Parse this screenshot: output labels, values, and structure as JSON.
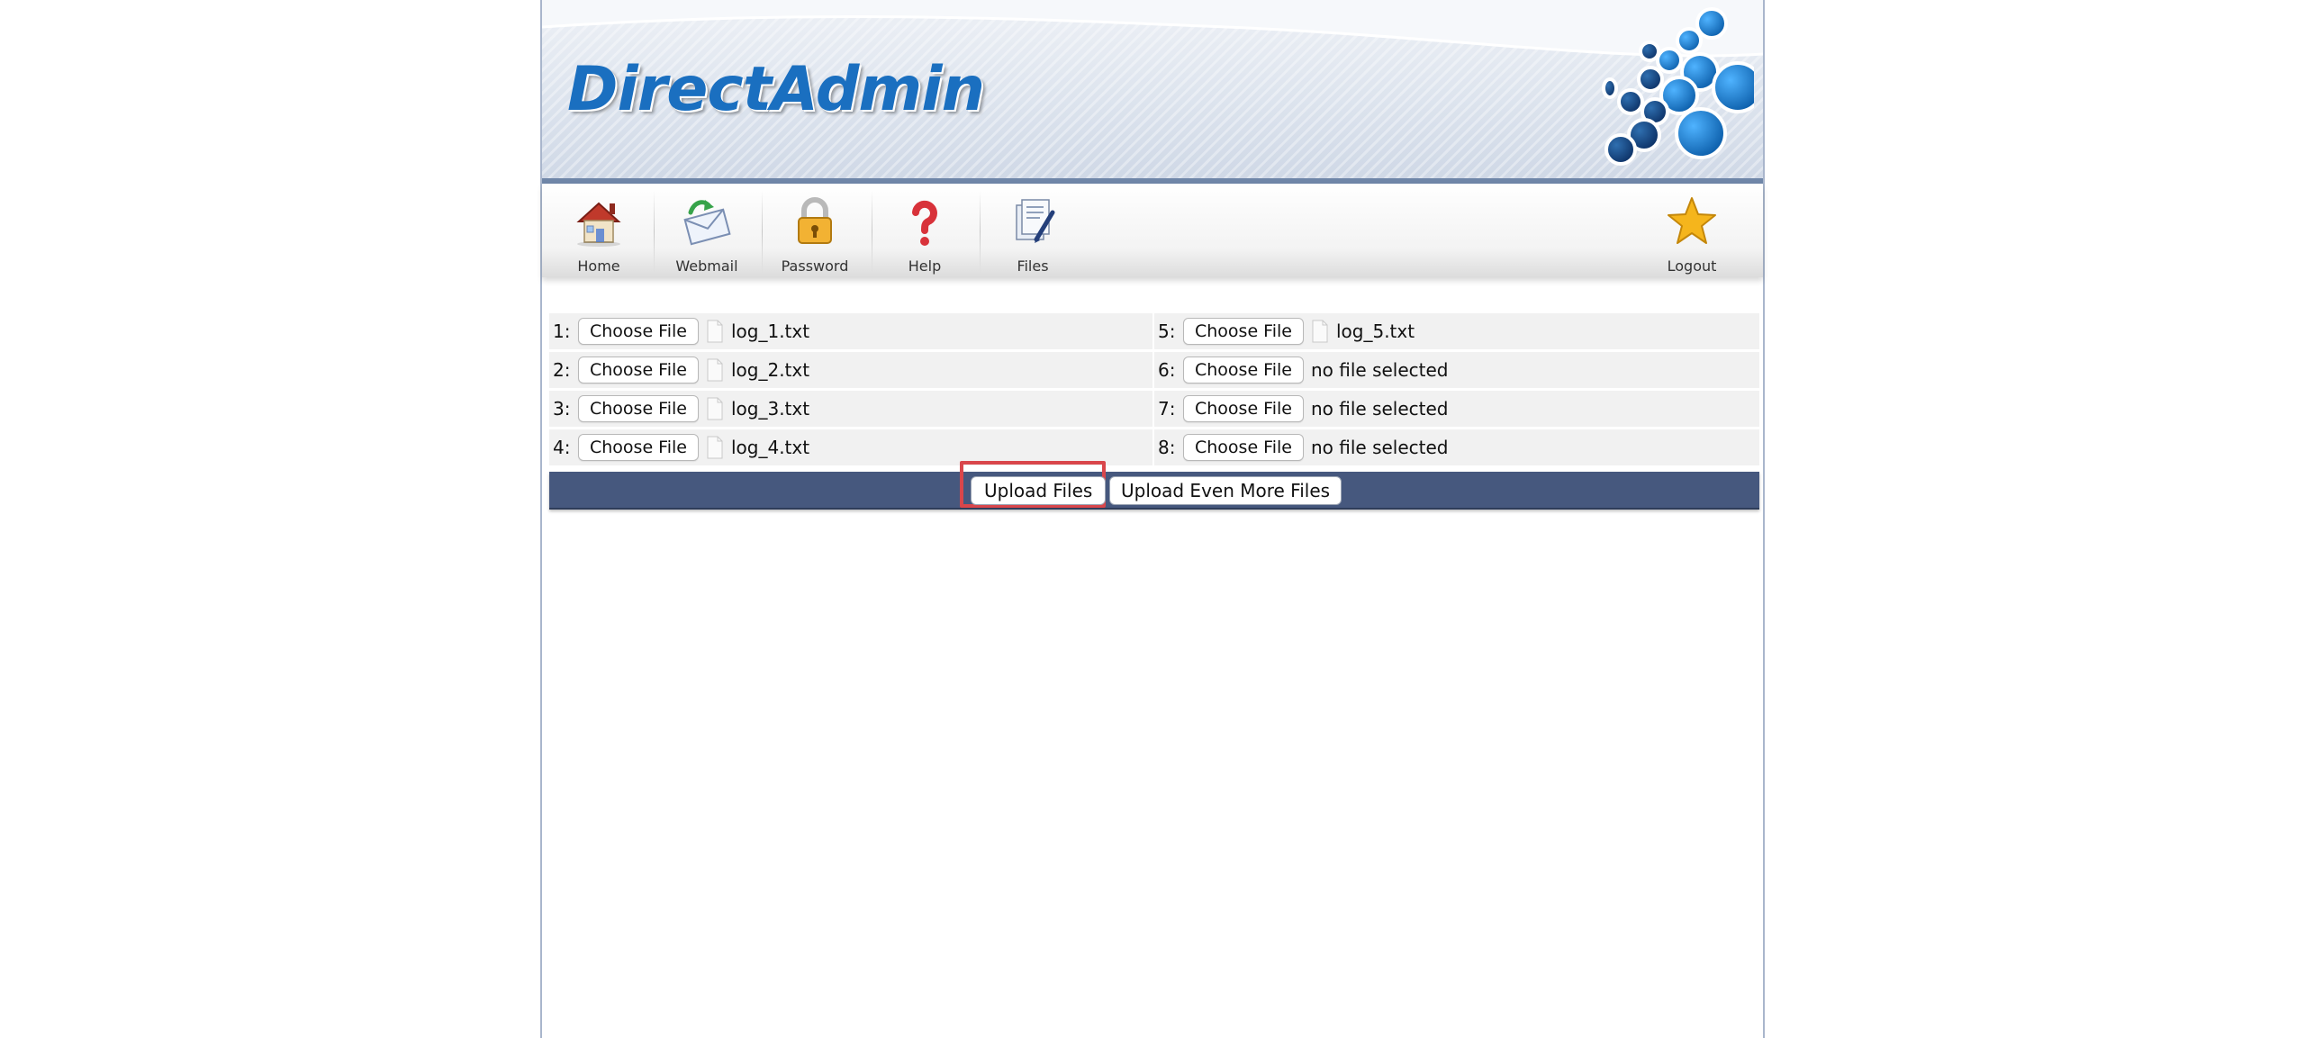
{
  "header": {
    "logo_text": "DirectAdmin"
  },
  "nav": {
    "items": [
      {
        "label": "Home",
        "icon": "house-icon"
      },
      {
        "label": "Webmail",
        "icon": "mail-icon"
      },
      {
        "label": "Password",
        "icon": "padlock-icon"
      },
      {
        "label": "Help",
        "icon": "question-mark-icon"
      },
      {
        "label": "Files",
        "icon": "files-icon"
      },
      {
        "label": "Logout",
        "icon": "star-icon"
      }
    ]
  },
  "upload": {
    "choose_label": "Choose File",
    "no_file_text": "no file selected",
    "rows": [
      {
        "left": {
          "num": "1:",
          "file": "log_1.txt"
        },
        "right": {
          "num": "5:",
          "file": "log_5.txt"
        }
      },
      {
        "left": {
          "num": "2:",
          "file": "log_2.txt"
        },
        "right": {
          "num": "6:",
          "file": null
        }
      },
      {
        "left": {
          "num": "3:",
          "file": "log_3.txt"
        },
        "right": {
          "num": "7:",
          "file": null
        }
      },
      {
        "left": {
          "num": "4:",
          "file": "log_4.txt"
        },
        "right": {
          "num": "8:",
          "file": null
        }
      }
    ],
    "upload_button": "Upload Files",
    "upload_more_button": "Upload Even More Files"
  },
  "colors": {
    "action_bar": "#46587e",
    "highlight": "#d9464b",
    "logo_blue": "#1a6fc0",
    "header_rule": "#6f86a8"
  }
}
